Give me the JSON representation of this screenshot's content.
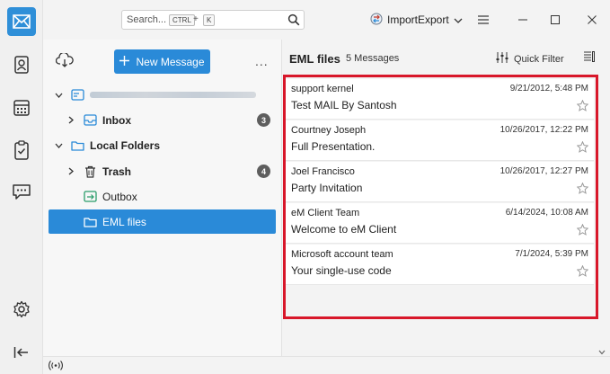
{
  "search": {
    "placeholder": "Search...",
    "shortcut_ctrl": "CTRL",
    "shortcut_plus": "+",
    "shortcut_key": "K"
  },
  "account": {
    "name": "ImportExport"
  },
  "toolbar": {
    "new_message_label": "New Message",
    "more_label": "..."
  },
  "folders": {
    "account_row": {
      "label": ""
    },
    "inbox": {
      "label": "Inbox",
      "count": "3"
    },
    "local_folders": {
      "label": "Local Folders"
    },
    "trash": {
      "label": "Trash",
      "count": "4"
    },
    "outbox": {
      "label": "Outbox"
    },
    "eml_files": {
      "label": "EML files"
    }
  },
  "message_list": {
    "title": "EML files",
    "count": "5 Messages",
    "quick_filter_label": "Quick Filter",
    "messages": [
      {
        "from": "support kernel",
        "date": "9/21/2012, 5:48 PM",
        "subject": "Test MAIL By Santosh"
      },
      {
        "from": "Courtney Joseph",
        "date": "10/26/2017, 12:22 PM",
        "subject": "Full Presentation."
      },
      {
        "from": "Joel Francisco",
        "date": "10/26/2017, 12:27 PM",
        "subject": "Party Invitation"
      },
      {
        "from": "eM Client Team",
        "date": "6/14/2024, 10:08 AM",
        "subject": "Welcome to eM Client"
      },
      {
        "from": "Microsoft account team",
        "date": "7/1/2024, 5:39 PM",
        "subject": "Your single-use code"
      }
    ]
  },
  "colors": {
    "accent": "#2a8ad8",
    "highlight": "#d8172a",
    "badge": "#5e5e5e"
  }
}
